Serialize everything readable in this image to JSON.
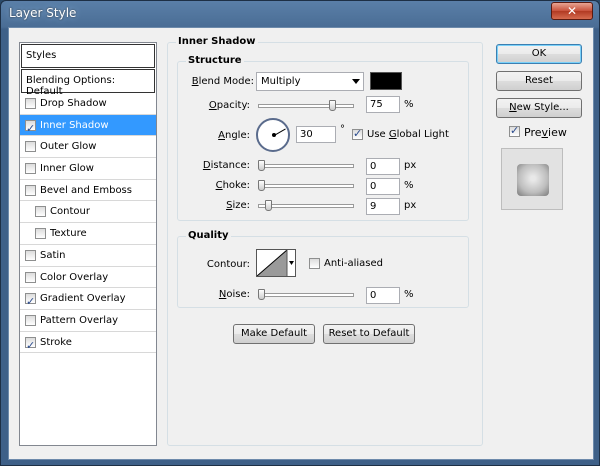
{
  "window": {
    "title": "Layer Style",
    "close_glyph": "✕"
  },
  "styles_panel": {
    "header": "Styles",
    "blending_options": "Blending Options: Default",
    "items": [
      {
        "label": "Drop Shadow",
        "checked": false,
        "selected": false,
        "sub": false
      },
      {
        "label": "Inner Shadow",
        "checked": true,
        "selected": true,
        "sub": false
      },
      {
        "label": "Outer Glow",
        "checked": false,
        "selected": false,
        "sub": false
      },
      {
        "label": "Inner Glow",
        "checked": false,
        "selected": false,
        "sub": false
      },
      {
        "label": "Bevel and Emboss",
        "checked": false,
        "selected": false,
        "sub": false
      },
      {
        "label": "Contour",
        "checked": false,
        "selected": false,
        "sub": true
      },
      {
        "label": "Texture",
        "checked": false,
        "selected": false,
        "sub": true
      },
      {
        "label": "Satin",
        "checked": false,
        "selected": false,
        "sub": false
      },
      {
        "label": "Color Overlay",
        "checked": false,
        "selected": false,
        "sub": false
      },
      {
        "label": "Gradient Overlay",
        "checked": true,
        "selected": false,
        "sub": false
      },
      {
        "label": "Pattern Overlay",
        "checked": false,
        "selected": false,
        "sub": false
      },
      {
        "label": "Stroke",
        "checked": true,
        "selected": false,
        "sub": false
      }
    ]
  },
  "inner_shadow": {
    "title": "Inner Shadow",
    "structure": {
      "title": "Structure",
      "blend_mode_label": "Blend Mode:",
      "blend_mode_value": "Multiply",
      "shadow_color": "#000000",
      "opacity_label": "Opacity:",
      "opacity_value": "75",
      "opacity_unit": "%",
      "angle_label": "Angle:",
      "angle_value": "30",
      "angle_unit": "°",
      "use_global_light_label": "Use Global Light",
      "use_global_light_checked": true,
      "distance_label": "Distance:",
      "distance_value": "0",
      "distance_unit": "px",
      "choke_label": "Choke:",
      "choke_value": "0",
      "choke_unit": "%",
      "size_label": "Size:",
      "size_value": "9",
      "size_unit": "px"
    },
    "quality": {
      "title": "Quality",
      "contour_label": "Contour:",
      "anti_aliased_label": "Anti-aliased",
      "anti_aliased_checked": false,
      "noise_label": "Noise:",
      "noise_value": "0",
      "noise_unit": "%"
    },
    "make_default_label": "Make Default",
    "reset_default_label": "Reset to Default"
  },
  "actions": {
    "ok_label": "OK",
    "reset_label": "Reset",
    "new_style_label": "New Style...",
    "preview_label": "Preview",
    "preview_checked": true
  },
  "colors": {
    "selection": "#3399ff",
    "window_frame": "#4a6d95",
    "dialog_bg": "#f0f0f0"
  }
}
